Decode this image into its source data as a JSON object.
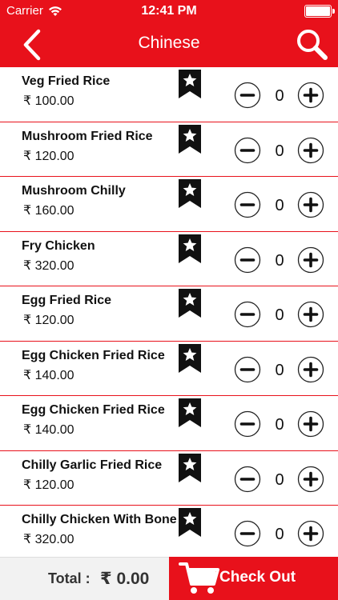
{
  "status_bar": {
    "carrier": "Carrier",
    "time": "12:41 PM",
    "icons": [
      "wifi-icon",
      "battery-icon"
    ]
  },
  "nav": {
    "title": "Chinese",
    "back_icon": "chevron-left-icon",
    "search_icon": "search-icon"
  },
  "colors": {
    "accent": "#e8111b",
    "footer_bg": "#f2f2f2"
  },
  "items": [
    {
      "name": "Veg Fried Rice",
      "price": "₹ 100.00",
      "qty": "0"
    },
    {
      "name": "Mushroom Fried Rice",
      "price": "₹ 120.00",
      "qty": "0"
    },
    {
      "name": "Mushroom Chilly",
      "price": "₹ 160.00",
      "qty": "0"
    },
    {
      "name": "Fry Chicken",
      "price": "₹ 320.00",
      "qty": "0"
    },
    {
      "name": "Egg Fried Rice",
      "price": "₹ 120.00",
      "qty": "0"
    },
    {
      "name": "Egg Chicken Fried Rice",
      "price": "₹ 140.00",
      "qty": "0"
    },
    {
      "name": "Egg Chicken Fried Rice",
      "price": "₹ 140.00",
      "qty": "0"
    },
    {
      "name": "Chilly Garlic Fried Rice",
      "price": "₹ 120.00",
      "qty": "0"
    },
    {
      "name": "Chilly Chicken With Bone",
      "price": "₹ 320.00",
      "qty": "0"
    }
  ],
  "footer": {
    "total_label": "Total :",
    "total_value": "₹ 0.00",
    "checkout_label": "Check Out",
    "cart_icon": "cart-icon"
  }
}
